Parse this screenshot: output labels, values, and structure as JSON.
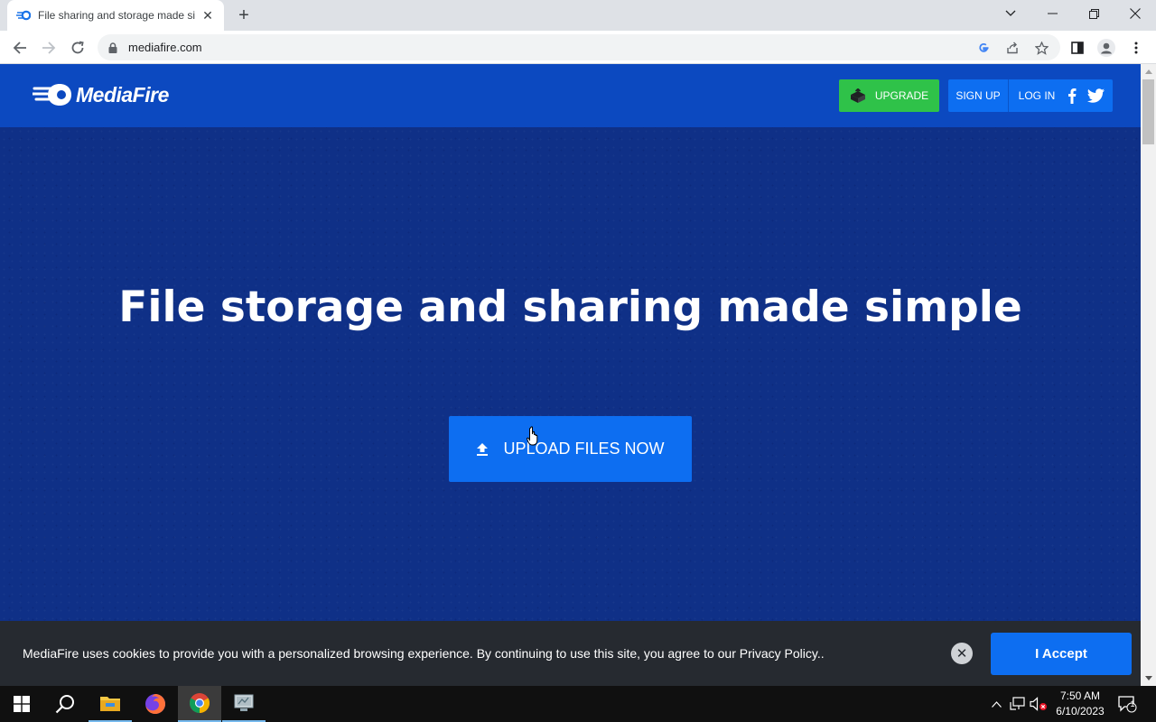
{
  "browser": {
    "tab_title": "File sharing and storage made si",
    "url": "mediafire.com"
  },
  "site": {
    "logo_text": "MediaFire",
    "upgrade_label": "UPGRADE",
    "signup_label": "SIGN UP",
    "login_label": "LOG IN"
  },
  "hero": {
    "title": "File storage and sharing made simple",
    "upload_label": "UPLOAD FILES NOW"
  },
  "cookie_banner": {
    "message": "MediaFire uses cookies to provide you with a personalized browsing experience. By continuing to use this site, you agree to our Privacy Policy..",
    "accept_label": "I Accept"
  },
  "taskbar": {
    "apps": [
      "start-icon",
      "search-icon",
      "file-explorer-icon",
      "firefox-icon",
      "chrome-icon",
      "remote-desktop-icon"
    ],
    "time": "7:50 AM",
    "date": "6/10/2023",
    "notification_count": "1"
  },
  "colors": {
    "header_blue": "#0c49c0",
    "hero_navy": "#0f3087",
    "button_blue": "#0d6ef1",
    "upgrade_green": "#2fc249",
    "cookie_bg": "#262a30"
  }
}
